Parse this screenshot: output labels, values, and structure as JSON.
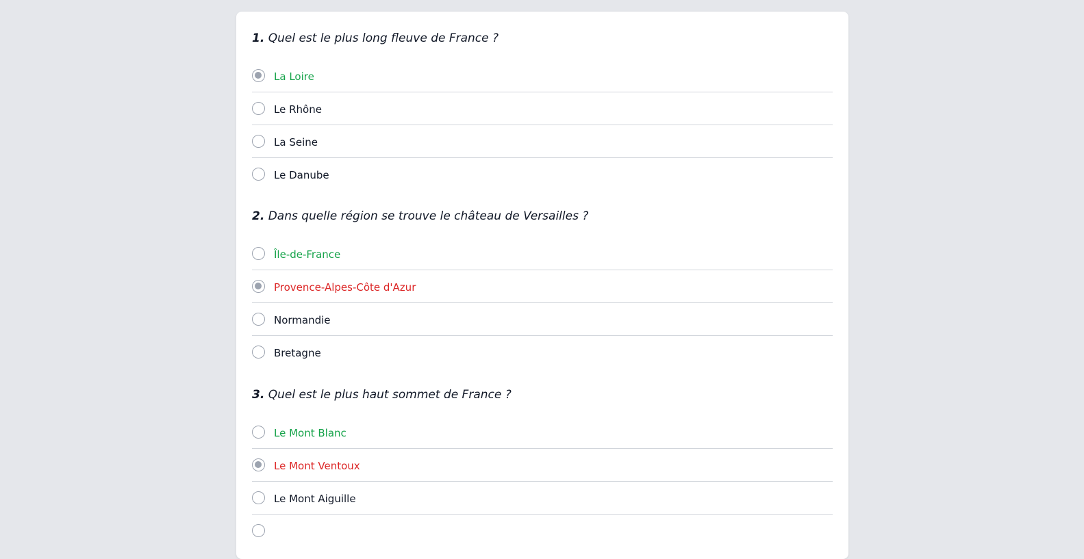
{
  "colors": {
    "correct": "#16a34a",
    "wrong": "#dc2626",
    "default": "#111827"
  },
  "questions": [
    {
      "number": "1.",
      "text": "Quel est le plus long fleuve de France ?",
      "options": [
        {
          "label": "La Loire",
          "selected": true,
          "status": "correct"
        },
        {
          "label": "Le Rhône",
          "selected": false,
          "status": "default"
        },
        {
          "label": "La Seine",
          "selected": false,
          "status": "default"
        },
        {
          "label": "Le Danube",
          "selected": false,
          "status": "default"
        }
      ]
    },
    {
      "number": "2.",
      "text": "Dans quelle région se trouve le château de Versailles ?",
      "options": [
        {
          "label": "Île-de-France",
          "selected": false,
          "status": "correct"
        },
        {
          "label": "Provence-Alpes-Côte d'Azur",
          "selected": true,
          "status": "wrong"
        },
        {
          "label": "Normandie",
          "selected": false,
          "status": "default"
        },
        {
          "label": "Bretagne",
          "selected": false,
          "status": "default"
        }
      ]
    },
    {
      "number": "3.",
      "text": "Quel est le plus haut sommet de France ?",
      "options": [
        {
          "label": "Le Mont Blanc",
          "selected": false,
          "status": "correct"
        },
        {
          "label": "Le Mont Ventoux",
          "selected": true,
          "status": "wrong"
        },
        {
          "label": "Le Mont Aiguille",
          "selected": false,
          "status": "default"
        },
        {
          "label": "",
          "selected": false,
          "status": "default"
        }
      ]
    }
  ]
}
